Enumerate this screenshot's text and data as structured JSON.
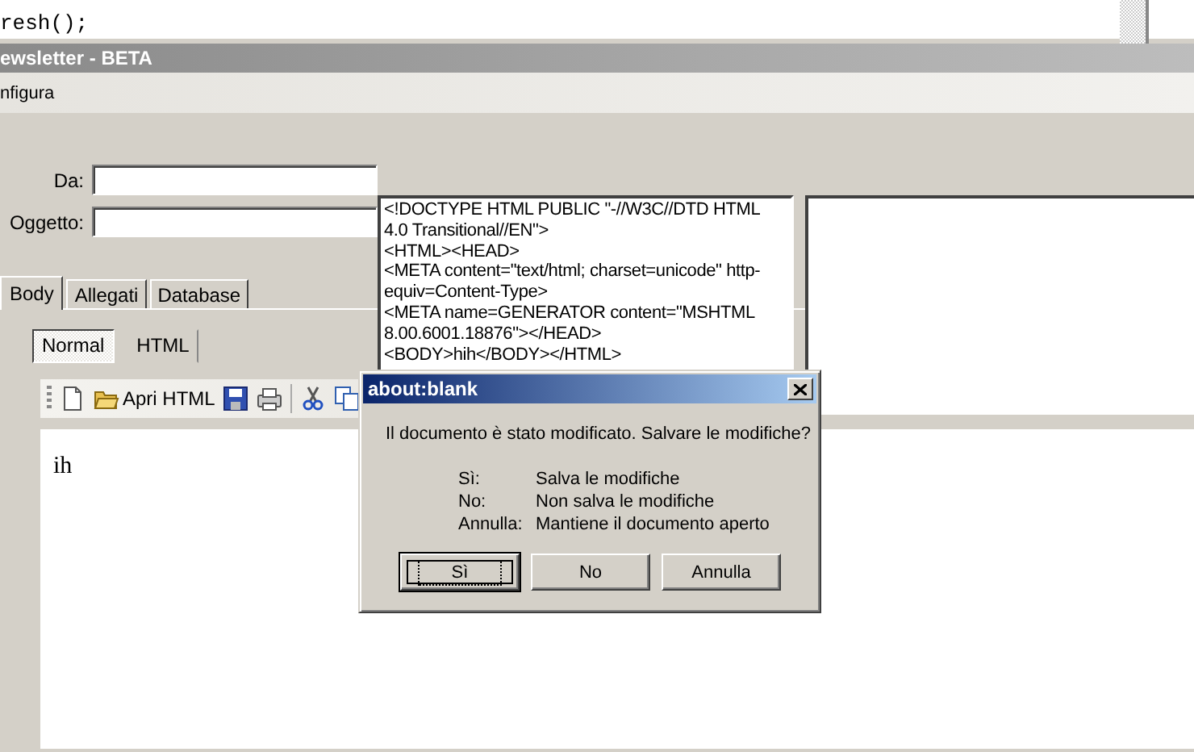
{
  "background_editor": {
    "code_line": "resh();"
  },
  "window": {
    "title": "ewsletter - BETA"
  },
  "menu_bar": [
    "nfigura"
  ],
  "form": {
    "fields": [
      {
        "label": "Da:"
      },
      {
        "label": "Oggetto:"
      }
    ]
  },
  "tabs": [
    {
      "label": "Body",
      "selected": true
    },
    {
      "label": "Allegati",
      "selected": false
    },
    {
      "label": "Database",
      "selected": false
    }
  ],
  "view_modes": [
    {
      "label": "Normal",
      "selected": true
    },
    {
      "label": "HTML",
      "selected": false
    }
  ],
  "toolbar": {
    "open_label": "Apri HTML"
  },
  "editor": {
    "body_text": "ih"
  },
  "html_source": {
    "lines": [
      "<!DOCTYPE HTML PUBLIC \"-//W3C//DTD HTML",
      "4.0 Transitional//EN\">",
      "<HTML><HEAD>",
      "<META content=\"text/html; charset=unicode\" http-",
      "equiv=Content-Type>",
      "<META name=GENERATOR content=\"MSHTML",
      "8.00.6001.18876\"></HEAD>",
      "<BODY>hih</BODY></HTML>"
    ]
  },
  "dialog": {
    "title": "about:blank",
    "message": "Il documento è stato modificato. Salvare le modifiche?",
    "options": [
      {
        "key": "Sì:",
        "description": "Salva le modifiche"
      },
      {
        "key": "No:",
        "description": "Non salva le modifiche"
      },
      {
        "key": "Annulla:",
        "description": "Mantiene il documento aperto"
      }
    ],
    "buttons": [
      {
        "label": "Sì",
        "focused": true
      },
      {
        "label": "No",
        "focused": false
      },
      {
        "label": "Annulla",
        "focused": false
      }
    ]
  }
}
